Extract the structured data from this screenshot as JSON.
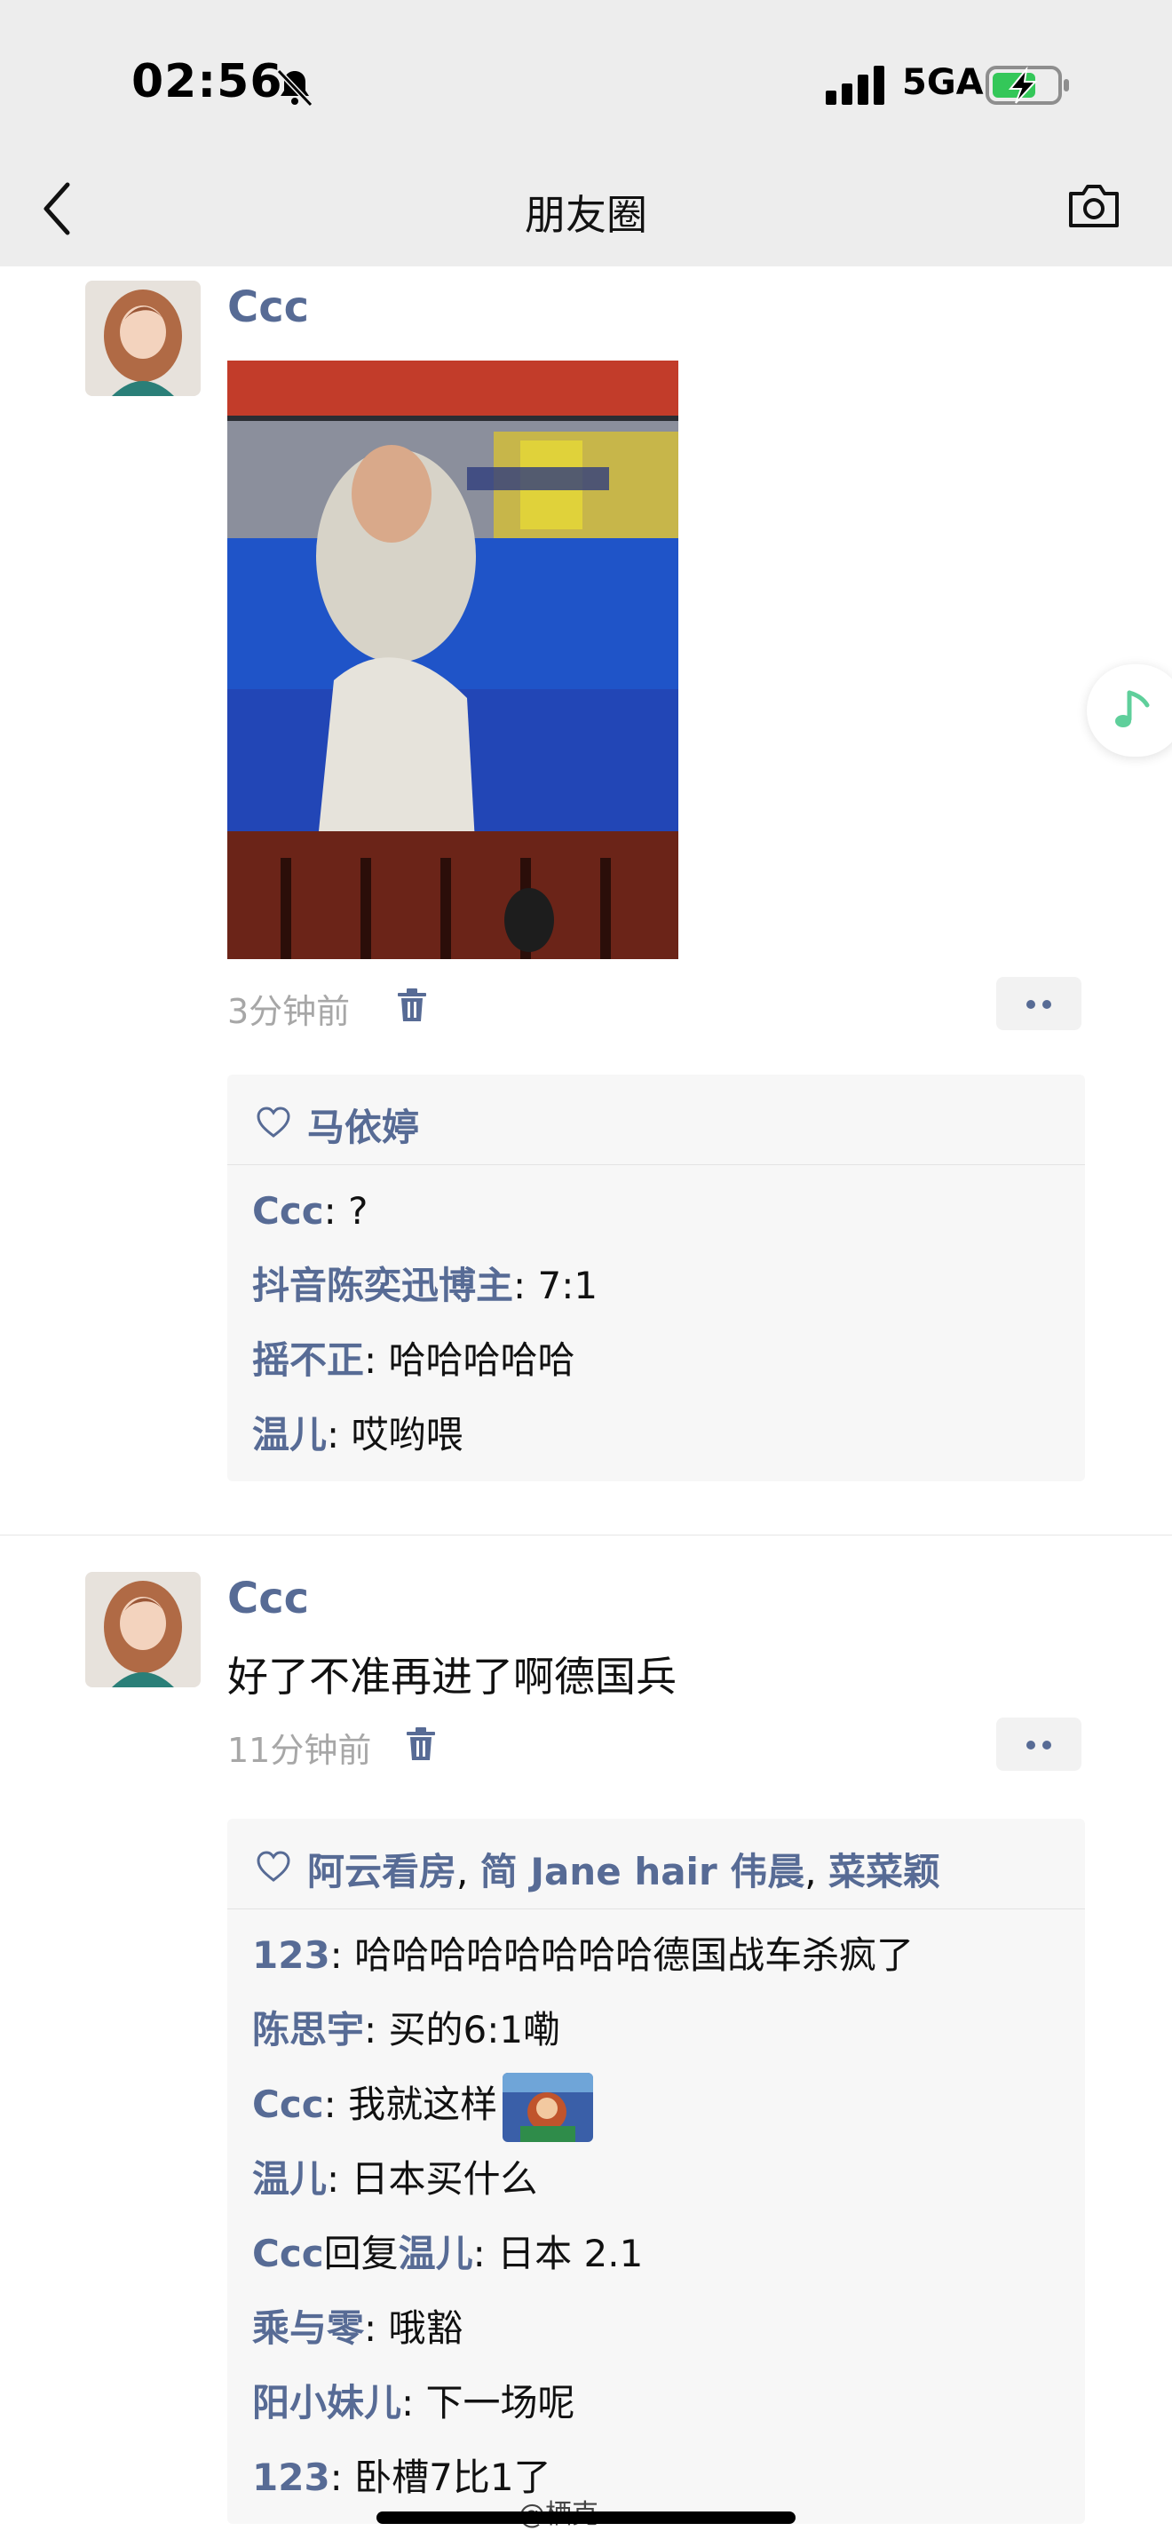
{
  "status_bar": {
    "time": "02:56",
    "network": "5GA"
  },
  "nav": {
    "title": "朋友圈"
  },
  "posts": [
    {
      "author": "Ccc",
      "time": "3分钟前",
      "likes": {
        "names": [
          "马依婷"
        ]
      },
      "comments": [
        {
          "name": "Ccc",
          "text": ": ?"
        },
        {
          "name": "抖音陈奕迅博主",
          "text": ": 7:1"
        },
        {
          "name": "摇不正",
          "text": ": 哈哈哈哈哈"
        },
        {
          "name": "温儿",
          "text": ": 哎哟喂"
        }
      ]
    },
    {
      "author": "Ccc",
      "text": "好了不准再进了啊德国兵",
      "time": "11分钟前",
      "likes": {
        "names": [
          "阿云看房",
          "简 Jane hair 伟晨",
          "菜菜颖"
        ],
        "separator": ", "
      },
      "comments": [
        {
          "name": "123",
          "text": ": 哈哈哈哈哈哈哈哈德国战车杀疯了"
        },
        {
          "name": "陈思宇",
          "text": ": 买的6:1嘞"
        },
        {
          "name": "Ccc",
          "text": ": 我就这样"
        },
        {
          "name": "温儿",
          "text": ": 日本买什么"
        },
        {
          "name": "Ccc",
          "reply_word": "回复",
          "reply_to": "温儿",
          "text": ": 日本 2.1"
        },
        {
          "name": "乘与零",
          "text": ": 哦豁"
        },
        {
          "name": "阳小妹儿",
          "text": ": 下一场呢"
        },
        {
          "name": "123",
          "text": ": 卧槽7比1了"
        }
      ]
    }
  ],
  "watermark": "@栖克",
  "colors": {
    "name_link": "#576b95",
    "header_bg": "#ededed",
    "panel_bg": "#f7f7f7",
    "music_green": "#5fcf9b"
  }
}
